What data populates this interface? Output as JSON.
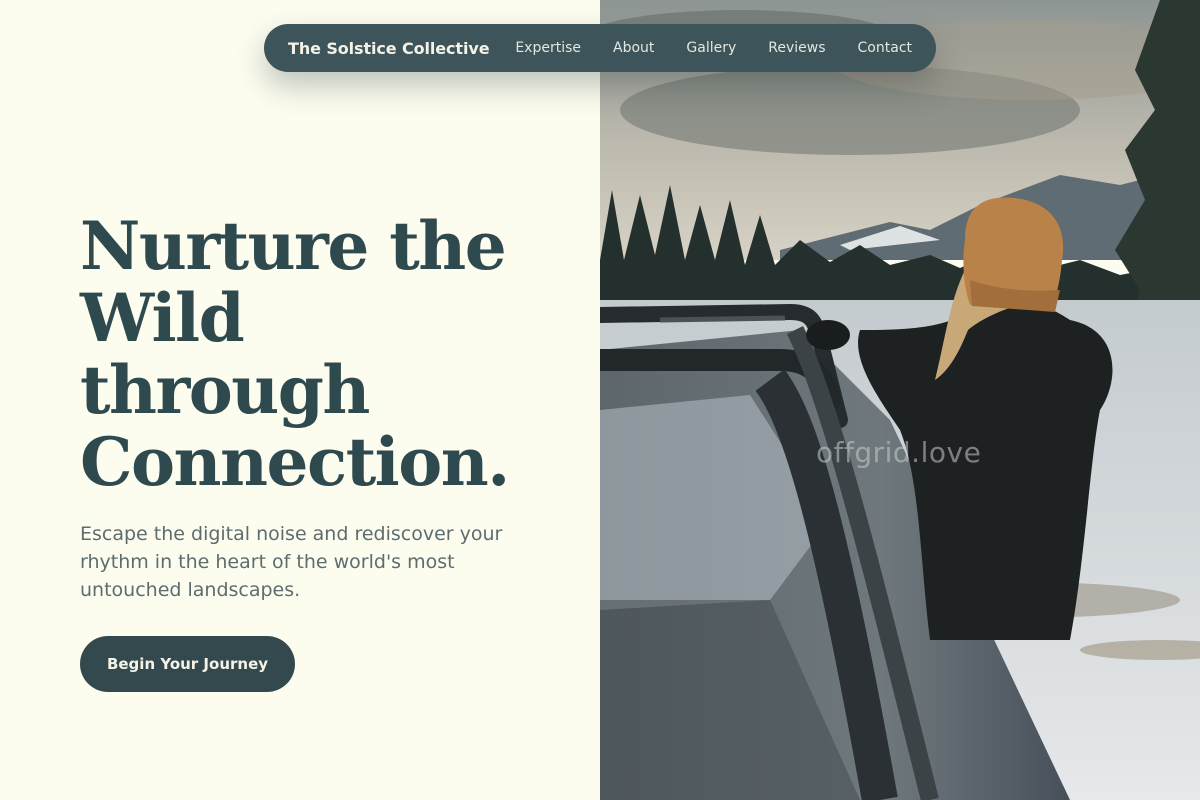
{
  "nav": {
    "brand": "The Solstice Collective",
    "links": [
      "Expertise",
      "About",
      "Gallery",
      "Reviews",
      "Contact"
    ]
  },
  "hero": {
    "headline_lines": [
      "Nurture the",
      "Wild",
      "through",
      "Connection."
    ],
    "subtext_lines": [
      "Escape the digital noise and rediscover your",
      "rhythm in the heart of the world's most",
      "untouched landscapes."
    ],
    "cta_label": "Begin Your Journey"
  },
  "photo": {
    "watermark": "offgrid.love"
  },
  "colors": {
    "accent": "#34494d",
    "background": "#fcfcef",
    "headline": "#2f4a4f",
    "body_text": "#5d6d6e"
  }
}
